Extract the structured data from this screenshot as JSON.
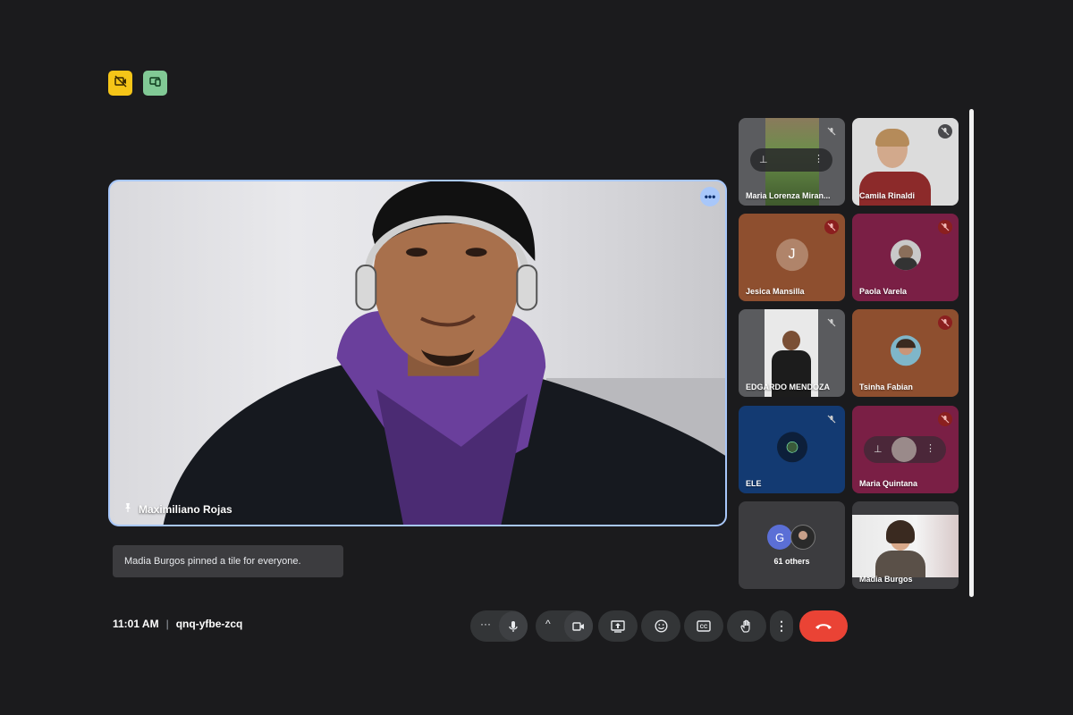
{
  "indicators": [
    {
      "name": "camera-off-indicator",
      "color": "#f5c518"
    },
    {
      "name": "devices-indicator",
      "color": "#81c995"
    }
  ],
  "main_tile": {
    "participant_name": "Maximiliano Rojas",
    "pinned": true
  },
  "toast": {
    "message": "Madia Burgos pinned a tile for everyone."
  },
  "side_tiles": [
    {
      "name": "Maria Lorenza Miran...",
      "mic": "muted",
      "style": "video"
    },
    {
      "name": "Camila Rinaldi",
      "mic": "muted",
      "style": "video"
    },
    {
      "name": "Jesica Mansilla",
      "mic": "muted-red",
      "style": "avatar",
      "initial": "J"
    },
    {
      "name": "Paola Varela",
      "mic": "muted-red",
      "style": "avatar"
    },
    {
      "name": "EDGARDO MENDOZA",
      "mic": "muted",
      "style": "video"
    },
    {
      "name": "Tsinha Fabian",
      "mic": "muted-red",
      "style": "avatar"
    },
    {
      "name": "ELE",
      "mic": "muted",
      "style": "avatar"
    },
    {
      "name": "Maria Quintana",
      "mic": "muted-red",
      "style": "avatar"
    },
    {
      "name": "61 others",
      "style": "overflow",
      "initial": "G"
    },
    {
      "name": "Madia Burgos",
      "style": "video"
    }
  ],
  "bottom_bar": {
    "time": "11:01 AM",
    "separator": "|",
    "meeting_code": "qnq-yfbe-zcq"
  },
  "controls": [
    "more-audio-options",
    "microphone",
    "more-video-options",
    "camera",
    "present-screen",
    "reactions",
    "captions",
    "raise-hand",
    "more-options",
    "leave-call"
  ],
  "colors": {
    "background": "#1b1b1d",
    "accent_border": "#a8c7fa",
    "end_call": "#ea4335"
  }
}
